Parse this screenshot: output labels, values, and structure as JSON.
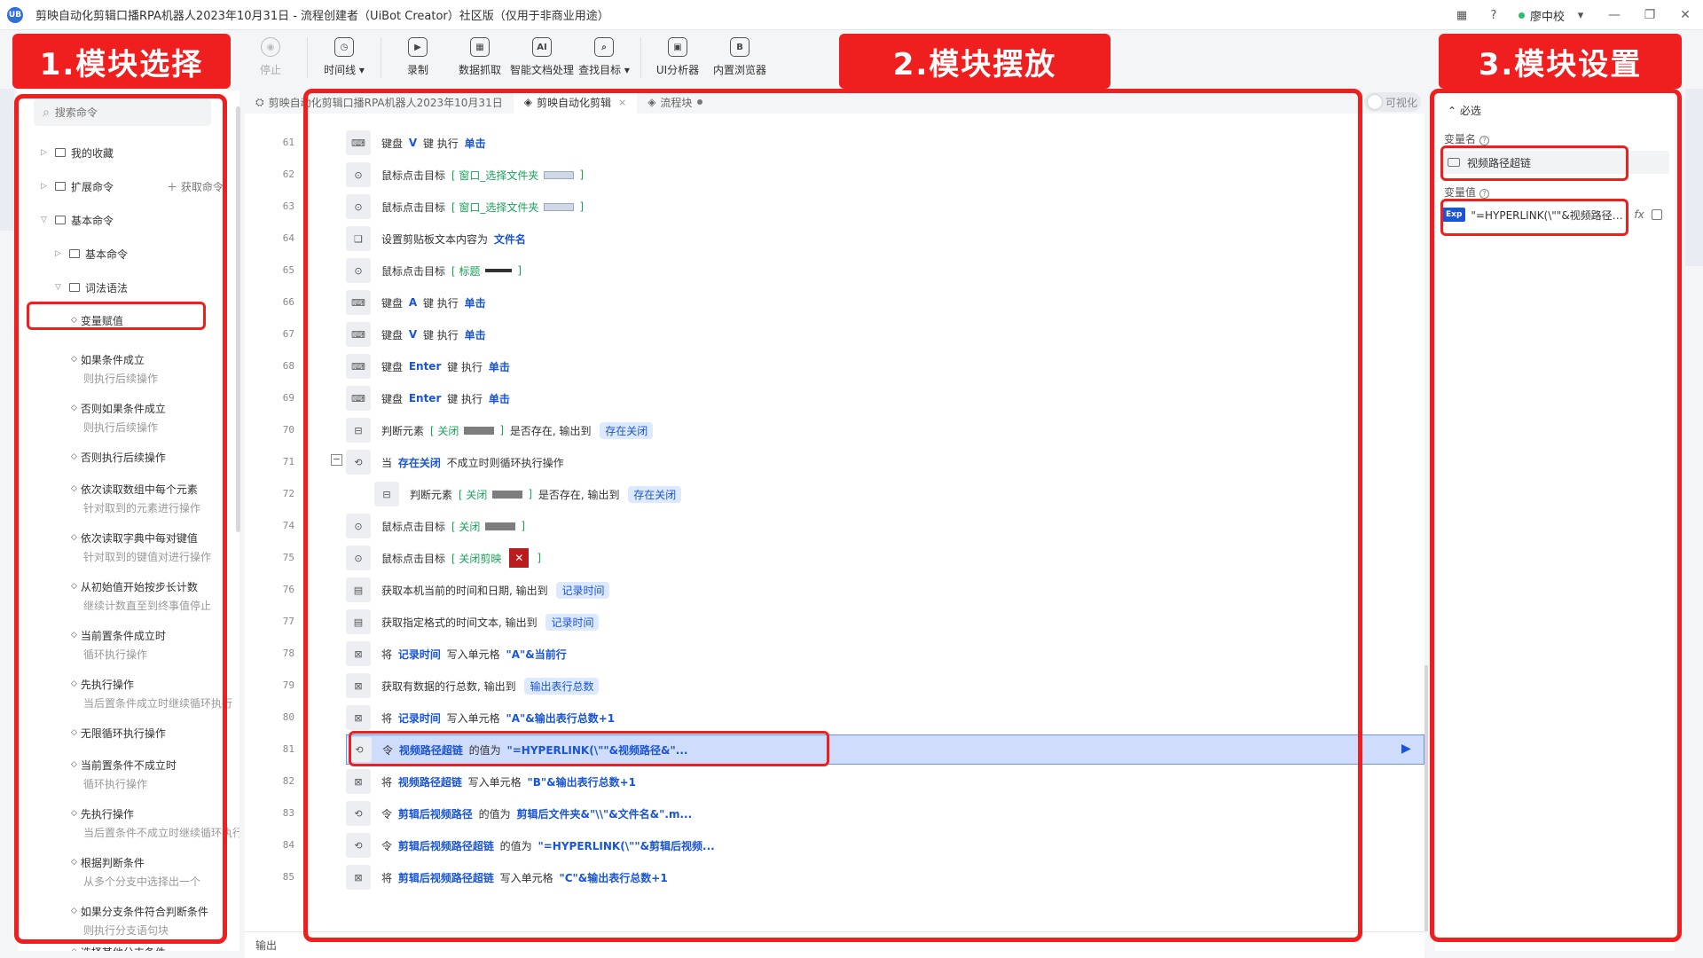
{
  "window": {
    "logo": "UB",
    "title": "剪映自动化剪辑口播RPA机器人2023年10月31日 - 流程创建者（UiBot Creator）社区版（仅用于非商业用途）",
    "user": "廖中校"
  },
  "toolbar": [
    {
      "label": "停止",
      "icon": "◉",
      "disabled": true
    },
    {
      "label": "时间线 ▾",
      "icon": "◷"
    },
    {
      "label": "录制",
      "icon": "▶"
    },
    {
      "label": "数据抓取",
      "icon": "▦"
    },
    {
      "label": "智能文档处理",
      "icon": "AI"
    },
    {
      "label": "查找目标 ▾",
      "icon": "⌕"
    },
    {
      "label": "UI分析器",
      "icon": "▣"
    },
    {
      "label": "内置浏览器",
      "icon": "B"
    }
  ],
  "annotations": {
    "label1": "1.模块选择",
    "label2": "2.模块摆放",
    "label3": "3.模块设置"
  },
  "left": {
    "search_placeholder": "搜索命令",
    "favorites": "我的收藏",
    "extensions": "扩展命令",
    "get_cmd": "＋ 获取命令",
    "basic": "基本命令",
    "basic_sub": "基本命令",
    "syntax": "词法语法",
    "commands": [
      {
        "title": "变量赋值",
        "sub": ""
      },
      {
        "title": "如果条件成立",
        "sub": "则执行后续操作"
      },
      {
        "title": "否则如果条件成立",
        "sub": "则执行后续操作"
      },
      {
        "title": "否则执行后续操作",
        "sub": ""
      },
      {
        "title": "依次读取数组中每个元素",
        "sub": "针对取到的元素进行操作"
      },
      {
        "title": "依次读取字典中每对键值",
        "sub": "针对取到的键值对进行操作"
      },
      {
        "title": "从初始值开始按步长计数",
        "sub": "继续计数直至到终事值停止"
      },
      {
        "title": "当前置条件成立时",
        "sub": "循环执行操作"
      },
      {
        "title": "先执行操作",
        "sub": "当后置条件成立时继续循环执行"
      },
      {
        "title": "无限循环执行操作",
        "sub": ""
      },
      {
        "title": "当前置条件不成立时",
        "sub": "循环执行操作"
      },
      {
        "title": "先执行操作",
        "sub": "当后置条件不成立时继续循环执行"
      },
      {
        "title": "根据判断条件",
        "sub": "从多个分支中选择出一个"
      },
      {
        "title": "如果分支条件符合判断条件",
        "sub": "则执行分支语句块"
      },
      {
        "title": "选择其他分支条件",
        "sub": ""
      }
    ]
  },
  "tabs": [
    {
      "label": "剪映自动化剪辑口播RPA机器人2023年10月31日",
      "icon": "⛭"
    },
    {
      "label": "剪映自动化剪辑",
      "icon": "◈",
      "active": true,
      "close": "×"
    },
    {
      "label": "流程块",
      "icon": "◈",
      "dot": true
    }
  ],
  "visual_toggle": "可视化",
  "code_lines": [
    {
      "n": "61",
      "icon": "⌨",
      "parts": [
        [
          "t",
          "键盘 "
        ],
        [
          "k",
          "V"
        ],
        [
          "t",
          " 键 执行 "
        ],
        [
          "k",
          "单击"
        ]
      ]
    },
    {
      "n": "62",
      "icon": "⊙",
      "parts": [
        [
          "t",
          "鼠标点击目标 "
        ],
        [
          "g",
          "[ 窗口_选择文件夹"
        ],
        [
          "img",
          "light"
        ],
        [
          "g",
          "]"
        ]
      ]
    },
    {
      "n": "63",
      "icon": "⊙",
      "parts": [
        [
          "t",
          "鼠标点击目标 "
        ],
        [
          "g",
          "[ 窗口_选择文件夹"
        ],
        [
          "img",
          "light"
        ],
        [
          "g",
          "]"
        ]
      ]
    },
    {
      "n": "64",
      "icon": "❏",
      "parts": [
        [
          "t",
          "设置剪贴板文本内容为 "
        ],
        [
          "k",
          "文件名"
        ]
      ]
    },
    {
      "n": "65",
      "icon": "⊙",
      "parts": [
        [
          "t",
          "鼠标点击目标 "
        ],
        [
          "g",
          "[ 标题"
        ],
        [
          "img",
          "dark"
        ],
        [
          "g",
          "]"
        ]
      ]
    },
    {
      "n": "66",
      "icon": "⌨",
      "parts": [
        [
          "t",
          "键盘 "
        ],
        [
          "k",
          "A"
        ],
        [
          "t",
          " 键 执行 "
        ],
        [
          "k",
          "单击"
        ]
      ]
    },
    {
      "n": "67",
      "icon": "⌨",
      "parts": [
        [
          "t",
          "键盘 "
        ],
        [
          "k",
          "V"
        ],
        [
          "t",
          " 键 执行 "
        ],
        [
          "k",
          "单击"
        ]
      ]
    },
    {
      "n": "68",
      "icon": "⌨",
      "parts": [
        [
          "t",
          "键盘 "
        ],
        [
          "k",
          "Enter"
        ],
        [
          "t",
          " 键 执行 "
        ],
        [
          "k",
          "单击"
        ]
      ]
    },
    {
      "n": "69",
      "icon": "⌨",
      "parts": [
        [
          "t",
          "键盘 "
        ],
        [
          "k",
          "Enter"
        ],
        [
          "t",
          " 键 执行 "
        ],
        [
          "k",
          "单击"
        ]
      ]
    },
    {
      "n": "70",
      "icon": "⊟",
      "parts": [
        [
          "t",
          "判断元素 "
        ],
        [
          "g",
          "[ 关闭"
        ],
        [
          "img",
          "gray"
        ],
        [
          "g",
          "]"
        ],
        [
          "t",
          " 是否存在, 输出到 "
        ],
        [
          "c",
          "存在关闭"
        ]
      ]
    },
    {
      "n": "71",
      "icon": "⟲",
      "parts": [
        [
          "t",
          "当 "
        ],
        [
          "k",
          "存在关闭"
        ],
        [
          "t",
          " 不成立时则循环执行操作"
        ]
      ]
    },
    {
      "n": "72",
      "icon": "⊟",
      "indent": true,
      "parts": [
        [
          "t",
          "判断元素 "
        ],
        [
          "g",
          "[ 关闭"
        ],
        [
          "img",
          "gray"
        ],
        [
          "g",
          "]"
        ],
        [
          "t",
          " 是否存在, 输出到 "
        ],
        [
          "c",
          "存在关闭"
        ]
      ]
    },
    {
      "n": "74",
      "icon": "⊙",
      "parts": [
        [
          "t",
          "鼠标点击目标 "
        ],
        [
          "g",
          "[ 关闭"
        ],
        [
          "img",
          "gray"
        ],
        [
          "g",
          "]"
        ]
      ]
    },
    {
      "n": "75",
      "icon": "⊙",
      "parts": [
        [
          "t",
          "鼠标点击目标 "
        ],
        [
          "g",
          "[ 关闭剪映"
        ],
        [
          "x",
          "✕"
        ],
        [
          "g",
          "]"
        ]
      ]
    },
    {
      "n": "76",
      "icon": "▤",
      "parts": [
        [
          "t",
          "获取本机当前的时间和日期, 输出到 "
        ],
        [
          "c",
          "记录时间"
        ]
      ]
    },
    {
      "n": "77",
      "icon": "▤",
      "parts": [
        [
          "t",
          "获取指定格式的时间文本, 输出到 "
        ],
        [
          "c",
          "记录时间"
        ]
      ]
    },
    {
      "n": "78",
      "icon": "⊠",
      "parts": [
        [
          "t",
          "将 "
        ],
        [
          "k",
          "记录时间"
        ],
        [
          "t",
          " 写入单元格 "
        ],
        [
          "k",
          "\"A\"&当前行"
        ]
      ]
    },
    {
      "n": "79",
      "icon": "⊠",
      "parts": [
        [
          "t",
          "获取有数据的行总数, 输出到 "
        ],
        [
          "c",
          "输出表行总数"
        ]
      ]
    },
    {
      "n": "80",
      "icon": "⊠",
      "parts": [
        [
          "t",
          "将 "
        ],
        [
          "k",
          "记录时间"
        ],
        [
          "t",
          " 写入单元格 "
        ],
        [
          "k",
          "\"A\"&输出表行总数+1"
        ]
      ]
    },
    {
      "n": "81",
      "icon": "⟲",
      "sel": true,
      "parts": [
        [
          "t",
          "令 "
        ],
        [
          "k",
          "视频路径超链"
        ],
        [
          "t",
          " 的值为 "
        ],
        [
          "k",
          "\"=HYPERLINK(\\\"\"&视频路径&\"..."
        ]
      ]
    },
    {
      "n": "82",
      "icon": "⊠",
      "parts": [
        [
          "t",
          "将 "
        ],
        [
          "k",
          "视频路径超链"
        ],
        [
          "t",
          " 写入单元格 "
        ],
        [
          "k",
          "\"B\"&输出表行总数+1"
        ]
      ]
    },
    {
      "n": "83",
      "icon": "⟲",
      "parts": [
        [
          "t",
          "令 "
        ],
        [
          "k",
          "剪辑后视频路径"
        ],
        [
          "t",
          " 的值为 "
        ],
        [
          "k",
          "剪辑后文件夹&\"\\\\\"&文件名&\".m..."
        ]
      ]
    },
    {
      "n": "84",
      "icon": "⟲",
      "parts": [
        [
          "t",
          "令 "
        ],
        [
          "k",
          "剪辑后视频路径超链"
        ],
        [
          "t",
          " 的值为 "
        ],
        [
          "k",
          "\"=HYPERLINK(\\\"\"&剪辑后视频..."
        ]
      ]
    },
    {
      "n": "85",
      "icon": "⊠",
      "parts": [
        [
          "t",
          "将 "
        ],
        [
          "k",
          "剪辑后视频路径超链"
        ],
        [
          "t",
          " 写入单元格 "
        ],
        [
          "k",
          "\"C\"&输出表行总数+1"
        ]
      ]
    }
  ],
  "fold_symbol": "−",
  "play_symbol": "▶",
  "output_label": "输出",
  "right": {
    "required": "⌃ 必选",
    "var_name_label": "变量名",
    "var_name_value": "视频路径超链",
    "var_value_label": "变量值",
    "exp_badge": "Exp",
    "var_value": "\"=HYPERLINK(\\\"\"&视频路径&\"...",
    "fx": "fx"
  },
  "colors": {
    "accent": "#1a55d6",
    "annotation_red": "#ef1f1f",
    "selected_row": "#cfdcfb"
  }
}
